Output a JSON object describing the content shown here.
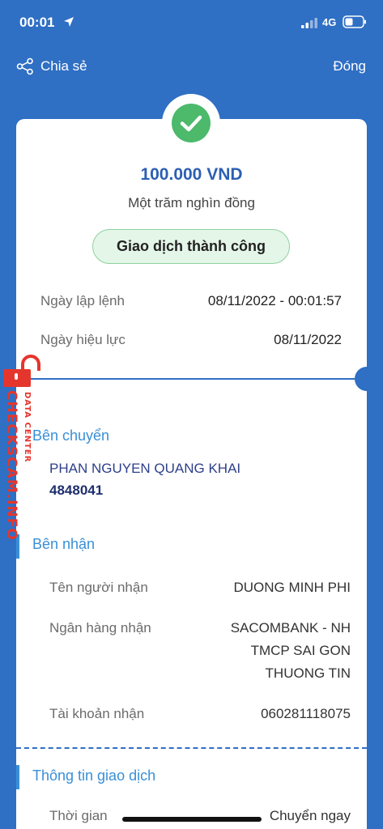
{
  "status_bar": {
    "time": "00:01",
    "network": "4G"
  },
  "header": {
    "share_label": "Chia sẻ",
    "close_label": "Đóng"
  },
  "receipt": {
    "amount": "100.000 VND",
    "amount_words": "Một trăm nghìn đồng",
    "status": "Giao dịch thành công",
    "order_date_label": "Ngày lập lệnh",
    "order_date_value": "08/11/2022 - 00:01:57",
    "effective_date_label": "Ngày hiệu lực",
    "effective_date_value": "08/11/2022"
  },
  "sender": {
    "section_title": "Bên chuyển",
    "name": "PHAN NGUYEN QUANG KHAI",
    "account": "4848041"
  },
  "receiver": {
    "section_title": "Bên nhận",
    "name_label": "Tên người nhận",
    "name_value": "DUONG MINH PHI",
    "bank_label": "Ngân hàng nhận",
    "bank_value_line1": "SACOMBANK - NH",
    "bank_value_line2": "TMCP SAI GON",
    "bank_value_line3": "THUONG TIN",
    "account_label": "Tài khoản nhận",
    "account_value": "060281118075"
  },
  "transaction": {
    "section_title": "Thông tin giao dịch",
    "time_label": "Thời gian",
    "time_value": "Chuyển ngay"
  },
  "watermark": {
    "main": "CHECKSCAM.INFO",
    "sub": "DATA CENTER"
  },
  "colors": {
    "background": "#2f6fc4",
    "accent": "#3a8fd6",
    "success": "#4cb96b",
    "amount": "#2c5fb3",
    "watermark": "#e5362d"
  }
}
